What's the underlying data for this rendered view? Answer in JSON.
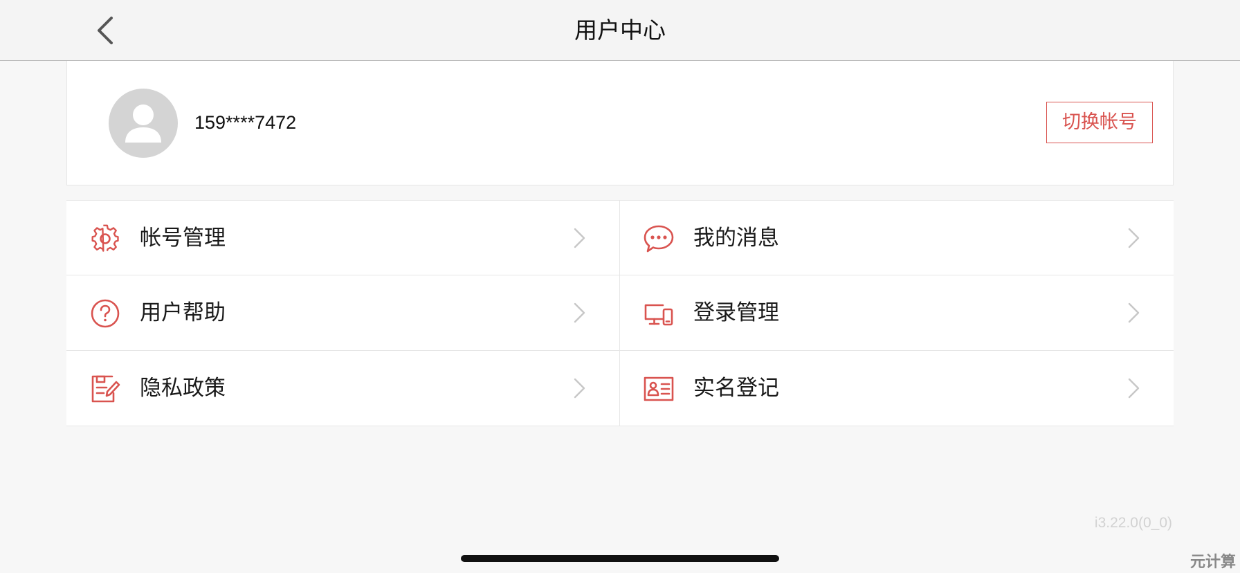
{
  "header": {
    "title": "用户中心",
    "back_icon": "chevron-left-icon"
  },
  "profile": {
    "avatar_icon": "user-avatar-icon",
    "phone": "159****7472",
    "switch_account_label": "切换帐号"
  },
  "menu": {
    "accent_color": "#d9534f",
    "items": [
      {
        "label": "帐号管理",
        "icon": "gear-icon"
      },
      {
        "label": "我的消息",
        "icon": "chat-bubble-icon"
      },
      {
        "label": "用户帮助",
        "icon": "question-circle-icon"
      },
      {
        "label": "登录管理",
        "icon": "devices-icon"
      },
      {
        "label": "隐私政策",
        "icon": "document-edit-icon"
      },
      {
        "label": "实名登记",
        "icon": "id-card-icon"
      }
    ]
  },
  "footer": {
    "version": "i3.22.0(0_0)",
    "watermark": "元计算"
  }
}
